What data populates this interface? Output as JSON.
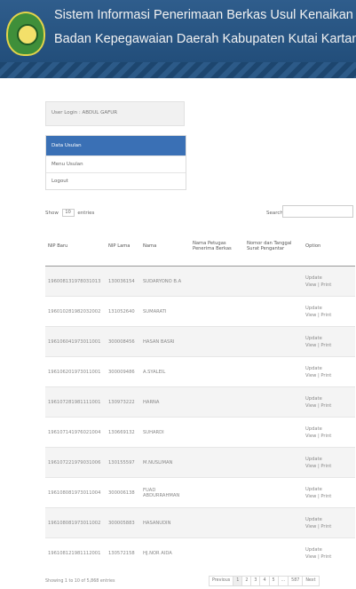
{
  "header": {
    "line1": "Sistem Informasi Penerimaan Berkas Usul Kenaikan Pangkat",
    "line2": "Badan Kepegawaian Daerah Kabupaten Kutai Kartanegara"
  },
  "user": {
    "login_text": "User Login : ABDUL GAFUR"
  },
  "menu": {
    "items": [
      {
        "label": "Data Usulan",
        "active": true
      },
      {
        "label": "Menu Usulan",
        "active": false
      },
      {
        "label": "Logout",
        "active": false
      }
    ]
  },
  "table_controls": {
    "show_prefix": "Show",
    "show_value": "10",
    "show_suffix": "entries",
    "search_label": "Search:",
    "search_value": ""
  },
  "table": {
    "columns": [
      "NIP Baru",
      "NIP Lama",
      "Nama",
      "Nama Petugas Penerima Berkas",
      "Nomor dan Tanggal Surat Pengantar",
      "Option"
    ],
    "rows": [
      [
        "196008131978031013",
        "130036154",
        "SUDARYONO B.A",
        "",
        "",
        "Update",
        "View | Print"
      ],
      [
        "196010281982032002",
        "131052640",
        "SUMARATI",
        "",
        "",
        "Update",
        "View | Print"
      ],
      [
        "196106041973011001",
        "300008456",
        "HASAN BASRI",
        "",
        "",
        "Update",
        "View | Print"
      ],
      [
        "196106201973011001",
        "300009486",
        "A.SYALEIL",
        "",
        "",
        "Update",
        "View | Print"
      ],
      [
        "196107281981111001",
        "130973222",
        "HARNA",
        "",
        "",
        "Update",
        "View | Print"
      ],
      [
        "196107141976021004",
        "130669132",
        "SUHARDI",
        "",
        "",
        "Update",
        "View | Print"
      ],
      [
        "196107221979031006",
        "130155597",
        "M.NUSLIMAN",
        "",
        "",
        "Update",
        "View | Print"
      ],
      [
        "196108081973011004",
        "300006138",
        "FUAD ABDURRAHMAN",
        "",
        "",
        "Update",
        "View | Print"
      ],
      [
        "196108081973011002",
        "300005883",
        "HASANUDIN",
        "",
        "",
        "Update",
        "View | Print"
      ]
    ],
    "last_row": [
      "196108121981112001",
      "130572158",
      "HJ.NOR AIDA",
      "",
      "",
      "Update",
      "View | Print"
    ]
  },
  "footer": {
    "info": "Showing 1 to 10 of 5,868 entries",
    "pagination": [
      "Previous",
      "1",
      "2",
      "3",
      "4",
      "5",
      "...",
      "587",
      "Next"
    ]
  },
  "colors": {
    "header_bg": "#2a5886",
    "menu_active": "#3a70b5"
  }
}
